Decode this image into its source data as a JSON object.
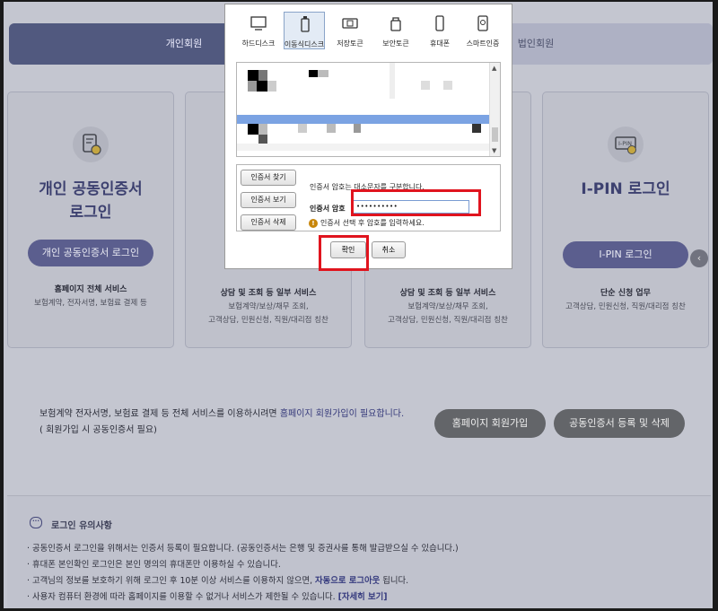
{
  "tabs": {
    "individual": "개인회원",
    "corporate": "법인회원"
  },
  "cards": [
    {
      "title_line1": "개인 공동인증서",
      "title_line2": "로그인",
      "button": "개인 공동인증서 로그인",
      "subtitle": "홈페이지 전체 서비스",
      "desc_line1": "보험계약, 전자서명, 보험료 결제 등",
      "desc_line2": ""
    },
    {
      "title_line1": "",
      "title_line2": "",
      "button": "",
      "subtitle": "상담 및 조회 등 일부 서비스",
      "desc_line1": "보험계약/보상/채무 조회,",
      "desc_line2": "고객상담, 민원신청, 직원/대리점 칭찬"
    },
    {
      "title_line1": "",
      "title_line2": "",
      "button": "",
      "subtitle": "상담 및 조회 등 일부 서비스",
      "desc_line1": "보험계약/보상/채무 조회,",
      "desc_line2": "고객상담, 민원신청, 직원/대리점 칭찬"
    },
    {
      "title_line1": "I-PIN 로그인",
      "title_line2": "",
      "button": "I-PIN 로그인",
      "subtitle": "단순 신청 업무",
      "desc_line1": "고객상담, 민원신청, 직원/대리점 칭찬",
      "desc_line2": ""
    }
  ],
  "card4_icon_text": "I-PIN",
  "join": {
    "line1_pre": "보험계약 전자서명, 보험료 결제 등 전체 서비스를 이용하시려면 ",
    "line1_highlight": "홈페이지 회원가입이 필요합니다.",
    "line2": "( 회원가입 시 공동인증서 필요)",
    "signup_button": "홈페이지 회원가입",
    "manage_button": "공동인증서 등록 및 삭제"
  },
  "notice": {
    "icon_text": "···",
    "title": "로그인 유의사항",
    "items": [
      {
        "pre": "· 공동인증서 로그인을 위해서는 인증서 등록이 필요합니다. (공동인증서는 은행 및 증권사를 통해 발급받으실 수 있습니다.)",
        "bold": "",
        "post": ""
      },
      {
        "pre": "· 휴대폰 본인확인 로그인은 본인 명의의 휴대폰만 이용하실 수 있습니다.",
        "bold": "",
        "post": ""
      },
      {
        "pre": "· 고객님의 정보를 보호하기 위해 로그인 후 10분 이상 서비스를 이용하지 않으면, ",
        "bold": "자동으로 로그아웃",
        "post": " 됩니다."
      },
      {
        "pre": "· 사용자 컴퓨터 환경에 따라 홈페이지를 이용할 수 없거나 서비스가 제한될 수 있습니다. ",
        "bold": "[자세히 보기]",
        "post": ""
      }
    ]
  },
  "side_arrow": "‹",
  "dialog": {
    "devices": [
      "하드디스크",
      "이동식디스크",
      "저장토큰",
      "보안토큰",
      "휴대폰",
      "스마트인증"
    ],
    "buttons": {
      "find": "인증서 찾기",
      "view": "인증서 보기",
      "delete": "인증서 삭제"
    },
    "case_note": "인증서 암호는 대소문자를 구분합니다.",
    "password_label": "인증서 암호",
    "password_value": "••••••••••",
    "hint": "인증서 선택 후 암호를 입력하세요.",
    "hint_icon": "!",
    "ok": "확인",
    "cancel": "취소"
  },
  "colors": {
    "accent": "#51597f",
    "highlight_box": "#e0141e",
    "button_dark": "#5b5e8e"
  }
}
